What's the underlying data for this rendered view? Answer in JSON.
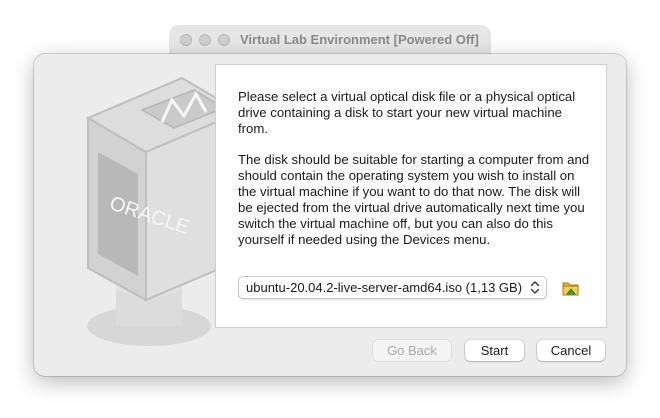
{
  "parent_window": {
    "title": "Virtual Lab Environment [Powered Off]"
  },
  "watermark": {
    "logo_text": "ORACLE"
  },
  "dialog": {
    "paragraph_1": "Please select a virtual optical disk file or a physical optical drive containing a disk to start your new virtual machine from.",
    "paragraph_2": "The disk should be suitable for starting a computer from and should contain the operating system you wish to install on the virtual machine if you want to do that now. The disk will be ejected from the virtual drive automatically next time you switch the virtual machine off, but you can also do this yourself if needed using the Devices menu.",
    "disk_selector": {
      "selected_value": "ubuntu-20.04.2-live-server-amd64.iso (1,13 GB)"
    },
    "folder_icon": "folder-open-icon",
    "buttons": {
      "back_label": "Go Back",
      "start_label": "Start",
      "cancel_label": "Cancel"
    }
  },
  "colors": {
    "dialog_bg": "#ececec",
    "panel_bg": "#ffffff",
    "disabled_text": "#a9a9a9"
  }
}
